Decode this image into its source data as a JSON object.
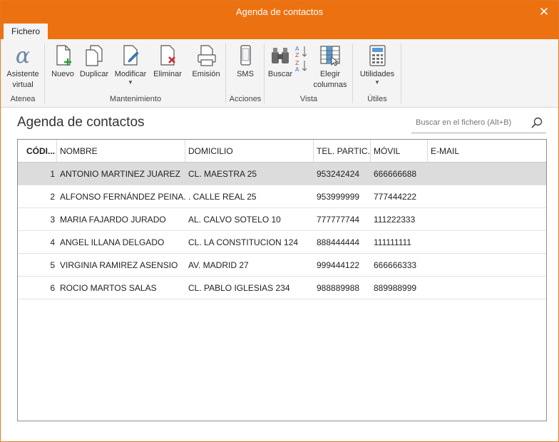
{
  "window": {
    "title": "Agenda de contactos",
    "close_glyph": "✕"
  },
  "tabs": [
    {
      "label": "Fichero",
      "active": true
    }
  ],
  "ribbon": {
    "groups": [
      {
        "label": "Atenea",
        "buttons": [
          {
            "label": "Asistente virtual",
            "icon": "alpha-icon"
          }
        ]
      },
      {
        "label": "Mantenimiento",
        "buttons": [
          {
            "label": "Nuevo",
            "icon": "new-document-icon"
          },
          {
            "label": "Duplicar",
            "icon": "duplicate-icon"
          },
          {
            "label": "Modificar",
            "icon": "edit-document-icon",
            "dropdown": true
          },
          {
            "label": "Eliminar",
            "icon": "delete-document-icon"
          },
          {
            "label": "Emisión",
            "icon": "print-icon"
          }
        ]
      },
      {
        "label": "Acciones",
        "buttons": [
          {
            "label": "SMS",
            "icon": "phone-icon"
          }
        ]
      },
      {
        "label": "Vista",
        "buttons": [
          {
            "label": "Buscar",
            "icon": "binoculars-icon"
          },
          {
            "label": "",
            "icon": "sort-az-icon"
          },
          {
            "label": "Elegir columnas",
            "icon": "columns-icon"
          }
        ]
      },
      {
        "label": "Útiles",
        "buttons": [
          {
            "label": "Utilidades",
            "icon": "calculator-icon",
            "dropdown": true
          }
        ]
      }
    ]
  },
  "main": {
    "heading": "Agenda de contactos",
    "search": {
      "placeholder": "Buscar en el fichero (Alt+B)"
    }
  },
  "table": {
    "columns": [
      "CÓDI...",
      "NOMBRE",
      "DOMICILIO",
      "TEL. PARTIC...",
      "MÓVIL",
      "E-MAIL"
    ],
    "rows": [
      [
        "1",
        "ANTONIO MARTINEZ JUAREZ",
        "CL. MAESTRA 25",
        "953242424",
        "666666688",
        ""
      ],
      [
        "2",
        "ALFONSO FERNÁNDEZ PEINA...",
        ". CALLE REAL 25",
        "953999999",
        "777444222",
        ""
      ],
      [
        "3",
        "MARIA FAJARDO JURADO",
        "AL. CALVO SOTELO 10",
        "777777744",
        "111222333",
        ""
      ],
      [
        "4",
        "ANGEL ILLANA DELGADO",
        "CL. LA CONSTITUCION 124",
        "888444444",
        "111111111",
        ""
      ],
      [
        "5",
        "VIRGINIA RAMIREZ ASENSIO",
        "AV. MADRID 27",
        "999444122",
        "666666333",
        ""
      ],
      [
        "6",
        "ROCIO MARTOS SALAS",
        "CL. PABLO IGLESIAS 234",
        "988889988",
        "889988999",
        ""
      ]
    ],
    "selected_row": 0
  },
  "colors": {
    "accent": "#ec7211",
    "selected_row": "#dcdcdc",
    "ribbon_bg": "#f4f4f4"
  }
}
